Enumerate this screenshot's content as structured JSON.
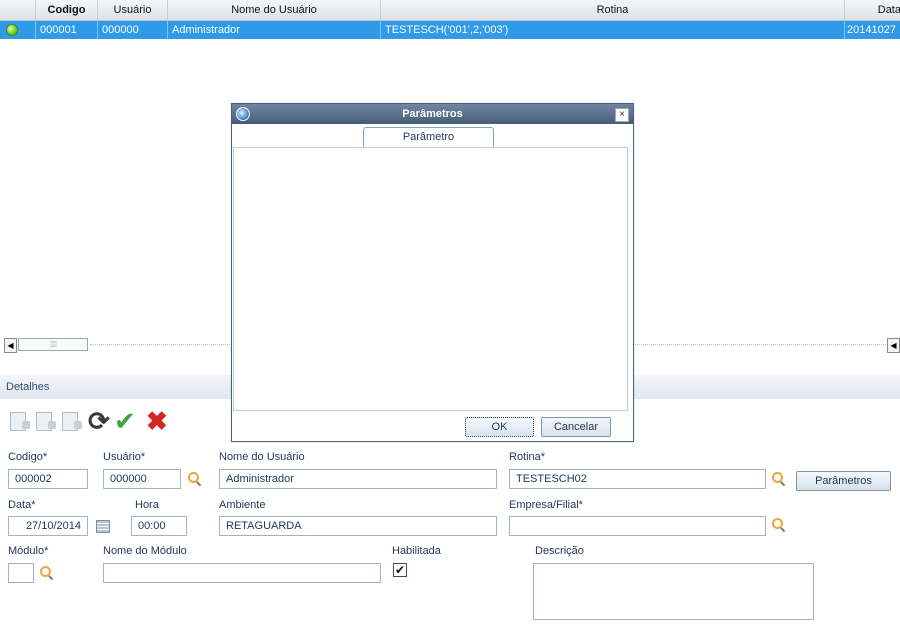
{
  "grid": {
    "columns": [
      "",
      "Codigo",
      "Usuário",
      "Nome do Usuário",
      "Rotina",
      "Data"
    ],
    "row": {
      "codigo": "000001",
      "usuario": "000000",
      "nome": "Administrador",
      "rotina": "TESTESCH('001',2,'003')",
      "data": "20141027"
    },
    "status": "active"
  },
  "details": {
    "title": "Detalhes",
    "toolbar": [
      "new-doc-icon",
      "edit-doc-icon",
      "copy-doc-icon",
      "refresh-icon",
      "confirm-check-icon",
      "cancel-x-icon"
    ]
  },
  "form": {
    "codigo_label": "Codigo*",
    "codigo_value": "000002",
    "usuario_label": "Usuário*",
    "usuario_value": "000000",
    "nome_usuario_label": "Nome do Usuário",
    "nome_usuario_value": "Administrador",
    "rotina_label": "Rotina*",
    "rotina_value": "TESTESCH02",
    "parametros_button": "Parâmetros",
    "data_label": "Data*",
    "data_value": "27/10/2014",
    "hora_label": "Hora",
    "hora_value": "00:00",
    "ambiente_label": "Ambiente",
    "ambiente_value": "RETAGUARDA",
    "empresa_label": "Empresa/Filial*",
    "empresa_value": "",
    "modulo_label": "Módulo*",
    "modulo_value": "",
    "nome_modulo_label": "Nome do Módulo",
    "nome_modulo_value": "",
    "habilitada_label": "Habilitada",
    "habilitada_checked": true,
    "descricao_label": "Descrição",
    "descricao_value": ""
  },
  "dialog": {
    "title": "Parâmetros",
    "tab": "Parâmetro",
    "ok": "OK",
    "cancel": "Cancelar"
  },
  "colors": {
    "selected_row": "#2e9ae8",
    "dialog_title": "#4f6480",
    "label_text": "#1d3557"
  }
}
